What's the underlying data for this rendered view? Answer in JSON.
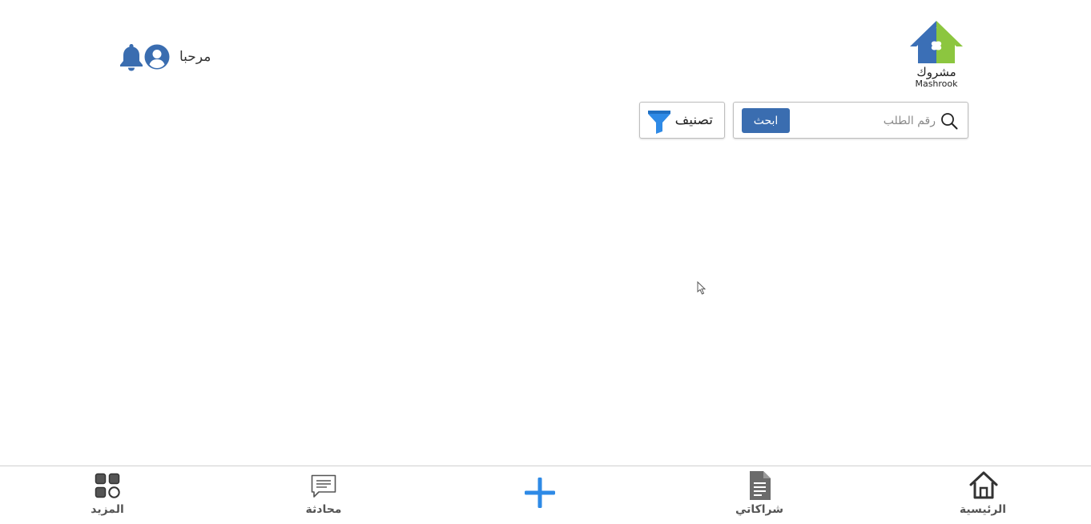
{
  "logo": {
    "name_ar": "مشروك",
    "name_en": "Mashrook"
  },
  "header": {
    "greeting": "مرحبا",
    "icons": [
      "bell-icon",
      "user-icon"
    ]
  },
  "search": {
    "placeholder": "رقم الطلب",
    "value": "",
    "button_label": "ابحث",
    "icon": "search-icon"
  },
  "filter": {
    "label": "تصنيف",
    "icon": "filter-icon"
  },
  "bottom_nav": {
    "items": [
      {
        "label": "الرئيسية",
        "icon": "home-icon"
      },
      {
        "label": "شراكاتي",
        "icon": "document-icon"
      },
      {
        "label": "",
        "icon": "plus-icon"
      },
      {
        "label": "محادثة",
        "icon": "chat-icon"
      },
      {
        "label": "المزيد",
        "icon": "grid-icon"
      }
    ]
  },
  "colors": {
    "primary_blue": "#3a6db0",
    "accent_blue": "#2e8ae6",
    "logo_green": "#8cc63f",
    "logo_blue": "#3b6fb6"
  }
}
